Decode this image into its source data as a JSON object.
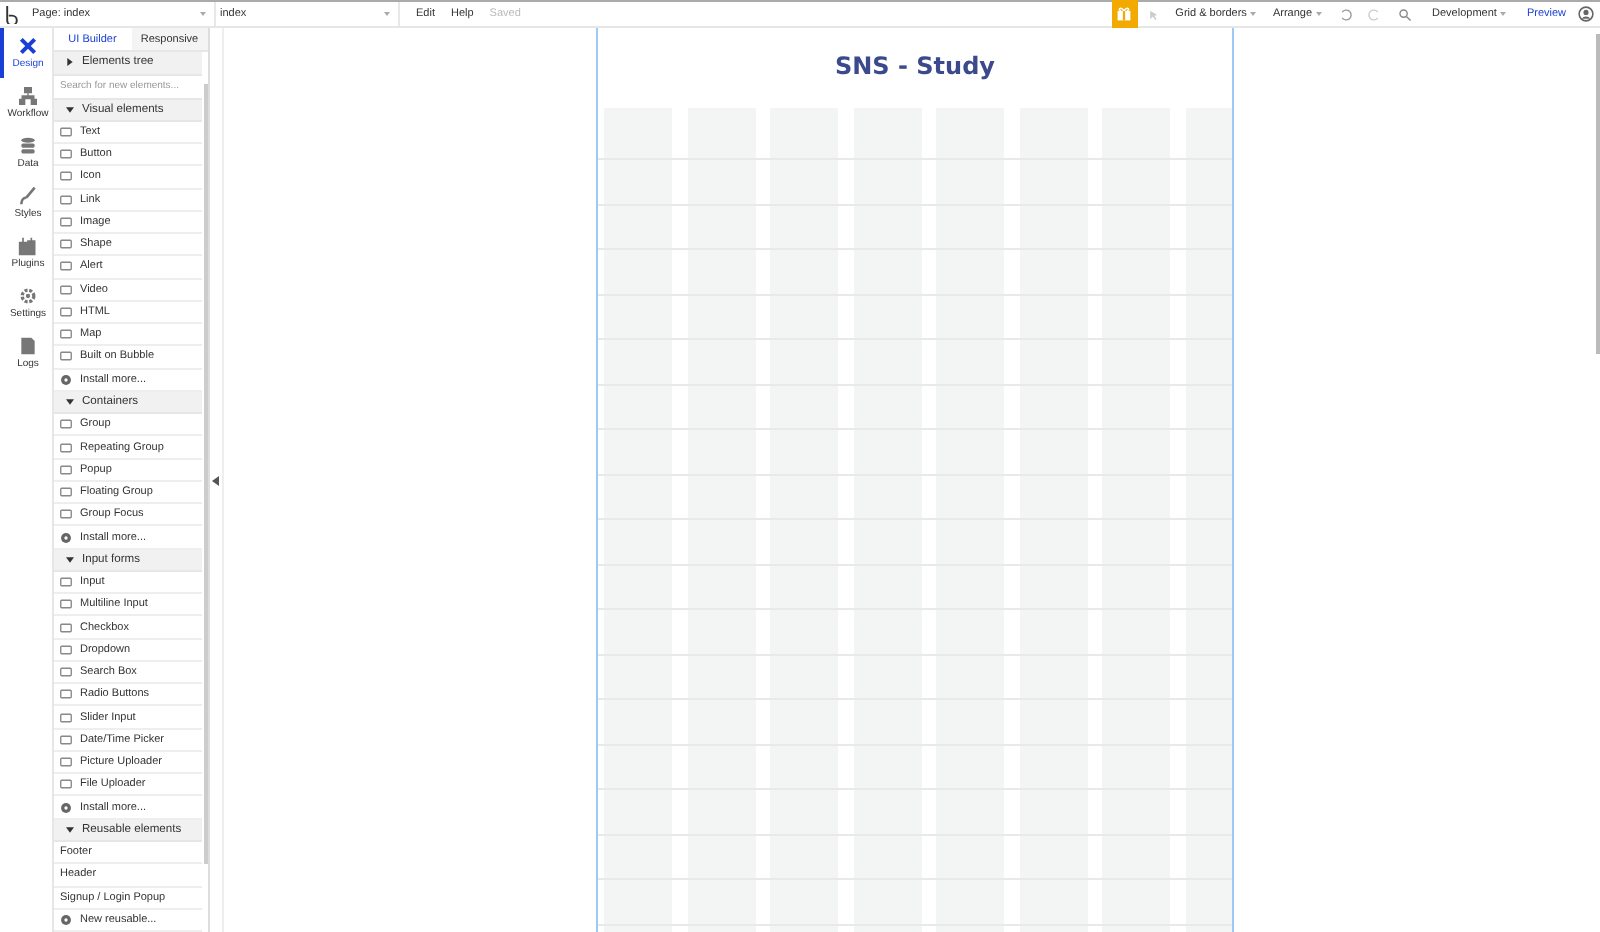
{
  "topbar": {
    "page": "Page: index",
    "page_dropdown": "index",
    "menu": [
      "Edit",
      "Help"
    ],
    "status": "Saved",
    "grid": "Grid & borders",
    "arrange": "Arrange",
    "environment": "Development",
    "preview": "Preview"
  },
  "rail": [
    {
      "label": "Design",
      "selected": true
    },
    {
      "label": "Workflow",
      "selected": false
    },
    {
      "label": "Data",
      "selected": false
    },
    {
      "label": "Styles",
      "selected": false
    },
    {
      "label": "Plugins",
      "selected": false
    },
    {
      "label": "Settings",
      "selected": false
    },
    {
      "label": "Logs",
      "selected": false
    }
  ],
  "panel_tabs": [
    {
      "label": "UI Builder",
      "selected": true
    },
    {
      "label": "Responsive",
      "selected": false
    }
  ],
  "elements_tree": {
    "label": "Elements tree",
    "expanded": false
  },
  "search": {
    "placeholder": "Search for new elements..."
  },
  "sections": [
    {
      "label": "Visual elements",
      "expanded": true,
      "items": [
        {
          "label": "Text",
          "kind": "element"
        },
        {
          "label": "Button",
          "kind": "element"
        },
        {
          "label": "Icon",
          "kind": "element"
        },
        {
          "label": "Link",
          "kind": "element"
        },
        {
          "label": "Image",
          "kind": "element"
        },
        {
          "label": "Shape",
          "kind": "element"
        },
        {
          "label": "Alert",
          "kind": "element"
        },
        {
          "label": "Video",
          "kind": "element"
        },
        {
          "label": "HTML",
          "kind": "element"
        },
        {
          "label": "Map",
          "kind": "element"
        },
        {
          "label": "Built on Bubble",
          "kind": "element"
        },
        {
          "label": "Install more...",
          "kind": "add"
        }
      ]
    },
    {
      "label": "Containers",
      "expanded": true,
      "items": [
        {
          "label": "Group",
          "kind": "element"
        },
        {
          "label": "Repeating Group",
          "kind": "element"
        },
        {
          "label": "Popup",
          "kind": "element"
        },
        {
          "label": "Floating Group",
          "kind": "element"
        },
        {
          "label": "Group Focus",
          "kind": "element"
        },
        {
          "label": "Install more...",
          "kind": "add"
        }
      ]
    },
    {
      "label": "Input forms",
      "expanded": true,
      "items": [
        {
          "label": "Input",
          "kind": "element"
        },
        {
          "label": "Multiline Input",
          "kind": "element"
        },
        {
          "label": "Checkbox",
          "kind": "element"
        },
        {
          "label": "Dropdown",
          "kind": "element"
        },
        {
          "label": "Search Box",
          "kind": "element"
        },
        {
          "label": "Radio Buttons",
          "kind": "element"
        },
        {
          "label": "Slider Input",
          "kind": "element"
        },
        {
          "label": "Date/Time Picker",
          "kind": "element"
        },
        {
          "label": "Picture Uploader",
          "kind": "element"
        },
        {
          "label": "File Uploader",
          "kind": "element"
        },
        {
          "label": "Install more...",
          "kind": "add"
        }
      ]
    },
    {
      "label": "Reusable elements",
      "expanded": true,
      "items": [
        {
          "label": "Footer",
          "kind": "plain"
        },
        {
          "label": "Header",
          "kind": "plain"
        },
        {
          "label": "Signup / Login Popup",
          "kind": "plain"
        },
        {
          "label": "New reusable...",
          "kind": "add"
        }
      ]
    }
  ],
  "canvas": {
    "title": "SNS - Study"
  }
}
